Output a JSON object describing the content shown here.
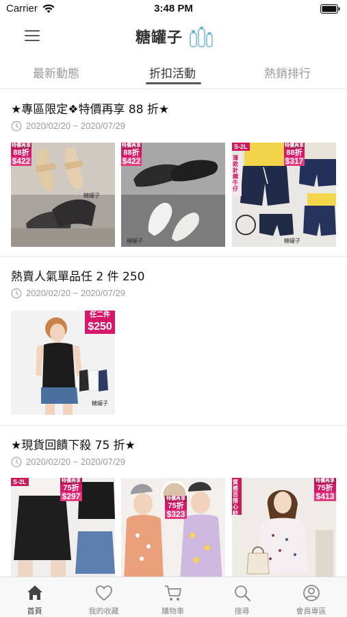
{
  "status": {
    "carrier": "Carrier",
    "time": "3:48 PM"
  },
  "header": {
    "logo_text": "糖罐子"
  },
  "tabs": [
    {
      "label": "最新動態",
      "active": false
    },
    {
      "label": "折扣活動",
      "active": true
    },
    {
      "label": "熱銷排行",
      "active": false
    }
  ],
  "sections": [
    {
      "title": "★專區限定❖特價再享 88 折★",
      "date": "2020/02/20 ~ 2020/07/29",
      "products": [
        {
          "tag_head": "特價再享",
          "tag_pct": "88折",
          "price": "$422",
          "desc": "sandals"
        },
        {
          "tag_head": "特價再享",
          "tag_pct": "88折",
          "price": "$422",
          "desc": "loafers"
        },
        {
          "size": "S-2L",
          "side_text": "薄款針織牛仔",
          "tag_head": "特價再享",
          "tag_pct": "88折",
          "price": "$317",
          "desc": "denim shorts"
        }
      ]
    },
    {
      "title": "熱賣人氣單品任 2 件 250",
      "date": "2020/02/20 ~ 2020/07/29",
      "products": [
        {
          "tag_head": "任二件",
          "price": "$250",
          "desc": "tank top"
        }
      ]
    },
    {
      "title": "★現貨回饋下殺 75 折★",
      "date": "2020/02/20 ~ 2020/07/29",
      "products": [
        {
          "size": "S-2L",
          "tag_head": "特價再享",
          "tag_pct": "75折",
          "price": "$297",
          "desc": "denim skirt"
        },
        {
          "tag_head": "特價再享",
          "tag_pct": "75折",
          "price": "$323",
          "desc": "printed tee"
        },
        {
          "side_text": "質感百搭心紗",
          "tag_head": "特價再享",
          "tag_pct": "75折",
          "price": "$413",
          "desc": "knit sweater"
        }
      ]
    }
  ],
  "bottom_nav": [
    {
      "label": "首頁",
      "icon": "home-icon",
      "active": true
    },
    {
      "label": "我的收藏",
      "icon": "heart-icon",
      "active": false
    },
    {
      "label": "購物車",
      "icon": "cart-icon",
      "active": false
    },
    {
      "label": "搜尋",
      "icon": "search-icon",
      "active": false
    },
    {
      "label": "會員專區",
      "icon": "user-icon",
      "active": false
    }
  ],
  "colors": {
    "accent": "#d6186a",
    "tab_active": "#333333",
    "tab_inactive": "#999999"
  }
}
